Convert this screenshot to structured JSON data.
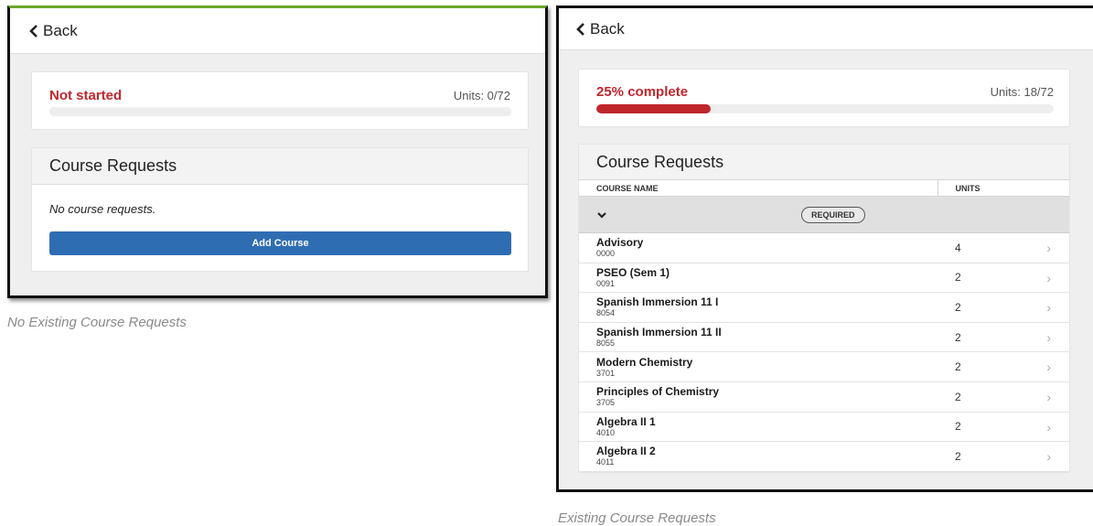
{
  "left": {
    "back_label": "Back",
    "status": "Not started",
    "units_label": "Units: 0/72",
    "progress": 0,
    "section_title": "Course Requests",
    "empty_message": "No course requests.",
    "add_button": "Add Course",
    "caption": "No Existing Course Requests"
  },
  "right": {
    "back_label": "Back",
    "status": "25% complete",
    "units_label": "Units: 18/72",
    "progress": 0.25,
    "section_title": "Course Requests",
    "columns": {
      "name": "COURSE NAME",
      "units": "UNITS"
    },
    "group_badge": "REQUIRED",
    "courses": [
      {
        "name": "Advisory",
        "number": "0000",
        "units": "4"
      },
      {
        "name": "PSEO (Sem 1)",
        "number": "0091",
        "units": "2"
      },
      {
        "name": "Spanish Immersion 11 I",
        "number": "8054",
        "units": "2"
      },
      {
        "name": "Spanish Immersion 11 II",
        "number": "8055",
        "units": "2"
      },
      {
        "name": "Modern Chemistry",
        "number": "3701",
        "units": "2"
      },
      {
        "name": "Principles of Chemistry",
        "number": "3705",
        "units": "2"
      },
      {
        "name": "Algebra II 1",
        "number": "4010",
        "units": "2"
      },
      {
        "name": "Algebra II 2",
        "number": "4011",
        "units": "2"
      }
    ],
    "caption": "Existing Course Requests"
  },
  "icons": {
    "back": "chevron-left-icon",
    "expand": "chevron-down-icon",
    "row": "chevron-right-icon"
  },
  "colors": {
    "status_red": "#c0262d",
    "button_blue": "#2f6db3"
  }
}
